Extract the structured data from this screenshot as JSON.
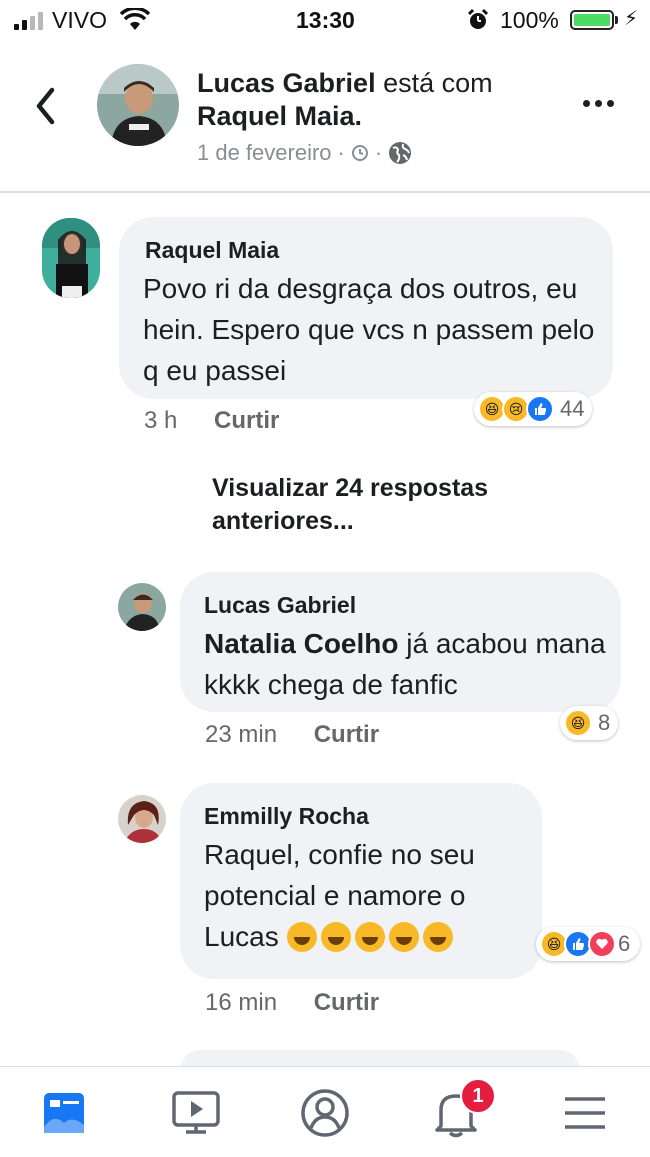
{
  "status_bar": {
    "carrier": "VIVO",
    "time": "13:30",
    "battery": "100%"
  },
  "header": {
    "author": "Lucas Gabriel",
    "connector": "está com",
    "tagged": "Raquel Maia.",
    "date": "1 de fevereiro",
    "separator": "·"
  },
  "comments": [
    {
      "author": "Raquel Maia",
      "text": "Povo ri da desgraça dos outros, eu hein. Espero que vcs n passem pelo q eu passei",
      "time": "3 h",
      "like_label": "Curtir",
      "reactions": [
        "haha",
        "sad",
        "like"
      ],
      "reaction_count": "44"
    },
    {
      "author": "Lucas Gabriel",
      "mention": "Natalia Coelho",
      "text": " já acabou mana kkkk chega de fanfic",
      "time": "23 min",
      "like_label": "Curtir",
      "reactions": [
        "haha"
      ],
      "reaction_count": "8"
    },
    {
      "author": "Emmilly Rocha",
      "text": "Raquel, confie no seu potencial e namore  o Lucas",
      "time": "16 min",
      "like_label": "Curtir",
      "reactions": [
        "haha",
        "like",
        "love"
      ],
      "reaction_count": "6"
    }
  ],
  "view_more": "Visualizar 24 respostas anteriores...",
  "nav": {
    "items": [
      "news-feed-icon",
      "watch-icon",
      "profile-icon",
      "notifications-icon",
      "menu-icon"
    ],
    "notification_badge": "1"
  },
  "colors": {
    "accent": "#1877f2",
    "bubble": "#f0f2f5",
    "badge": "#e41e3f"
  }
}
